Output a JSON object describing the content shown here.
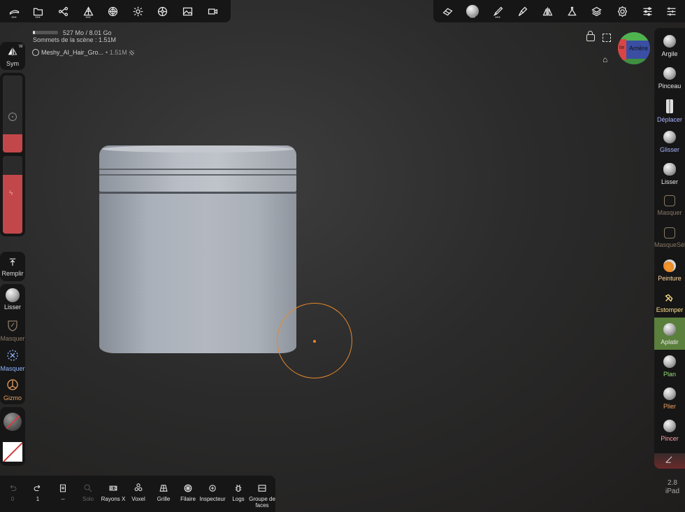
{
  "top_toolbar_left": [
    {
      "icon": "tools-icon"
    },
    {
      "icon": "folder-icon"
    },
    {
      "icon": "scene-graph-icon"
    },
    {
      "icon": "topology-icon"
    },
    {
      "icon": "mesh-icon"
    },
    {
      "icon": "lighting-icon"
    },
    {
      "icon": "material-icon"
    },
    {
      "icon": "image-icon"
    },
    {
      "icon": "video-icon"
    }
  ],
  "top_toolbar_right": [
    {
      "icon": "eraser-icon"
    },
    {
      "icon": "matcap-icon"
    },
    {
      "icon": "brush-icon"
    },
    {
      "icon": "paint-icon"
    },
    {
      "icon": "symmetry-icon"
    },
    {
      "icon": "flask-icon"
    },
    {
      "icon": "layers-icon"
    },
    {
      "icon": "settings-icon"
    },
    {
      "icon": "sliders-icon"
    },
    {
      "icon": "shelf-icon"
    }
  ],
  "scene_info": {
    "memory": "527 Mo / 8.01 Go",
    "vertices": "Sommets de la scène : 1.51M",
    "mesh_name": "Meshy_AI_Hair_Gro...",
    "mesh_count": "• 1.51M"
  },
  "left_panel": {
    "sym_label": "Sym",
    "sym_badge": "W",
    "remplir_label": "Remplir",
    "lisser_label": "Lisser",
    "masquer_label": "Masquer",
    "masquer2_label": "Masquer",
    "gizmo_label": "Gizmo"
  },
  "view_cube": {
    "back_label": "Arrière",
    "left_label": "ite"
  },
  "right_tools": [
    {
      "label": "Argile",
      "color": "#e6e6e6"
    },
    {
      "label": "Pinceau",
      "color": "#e6e6e6"
    },
    {
      "label": "Déplacer",
      "color": "#aab4ff"
    },
    {
      "label": "Glisser",
      "color": "#aab4ff"
    },
    {
      "label": "Lisser",
      "color": "#e6e6e6"
    },
    {
      "label": "Masquer",
      "color": "#8a7a66"
    },
    {
      "label": "MasqueSél",
      "color": "#8a7a66"
    },
    {
      "label": "Peinture",
      "color": "#ffd9a0"
    },
    {
      "label": "Estomper",
      "color": "#ffe08a"
    },
    {
      "label": "Aplatir",
      "color": "#e6e6e6",
      "active": true
    },
    {
      "label": "Plan",
      "color": "#9be07a"
    },
    {
      "label": "Plier",
      "color": "#f0a060"
    },
    {
      "label": "Pincer",
      "color": "#ffa0a0"
    }
  ],
  "bottom_toolbar": [
    {
      "label": "0",
      "icon": "undo-icon",
      "dim": true
    },
    {
      "label": "1",
      "icon": "redo-icon",
      "dim": false
    },
    {
      "label": "--",
      "icon": "page-icon",
      "dim": false
    },
    {
      "label": "Solo",
      "icon": "search-icon",
      "dim": true
    },
    {
      "label": "Rayons X",
      "icon": "xray-icon",
      "dim": false
    },
    {
      "label": "Voxel",
      "icon": "voxel-icon",
      "dim": false
    },
    {
      "label": "Grille",
      "icon": "grid-icon",
      "dim": false
    },
    {
      "label": "Filaire",
      "icon": "wireframe-icon",
      "dim": false
    },
    {
      "label": "Inspecteur",
      "icon": "inspector-icon",
      "dim": false
    },
    {
      "label": "Logs",
      "icon": "bug-icon",
      "dim": false
    },
    {
      "label": "Groupe de faces",
      "icon": "facegroup-icon",
      "dim": false
    }
  ],
  "version": {
    "number": "2.8",
    "device": "iPad"
  },
  "colors": {
    "accent": "#e8892a",
    "active_tool": "#5b7f3d",
    "red_swatch": "#c2474b"
  }
}
